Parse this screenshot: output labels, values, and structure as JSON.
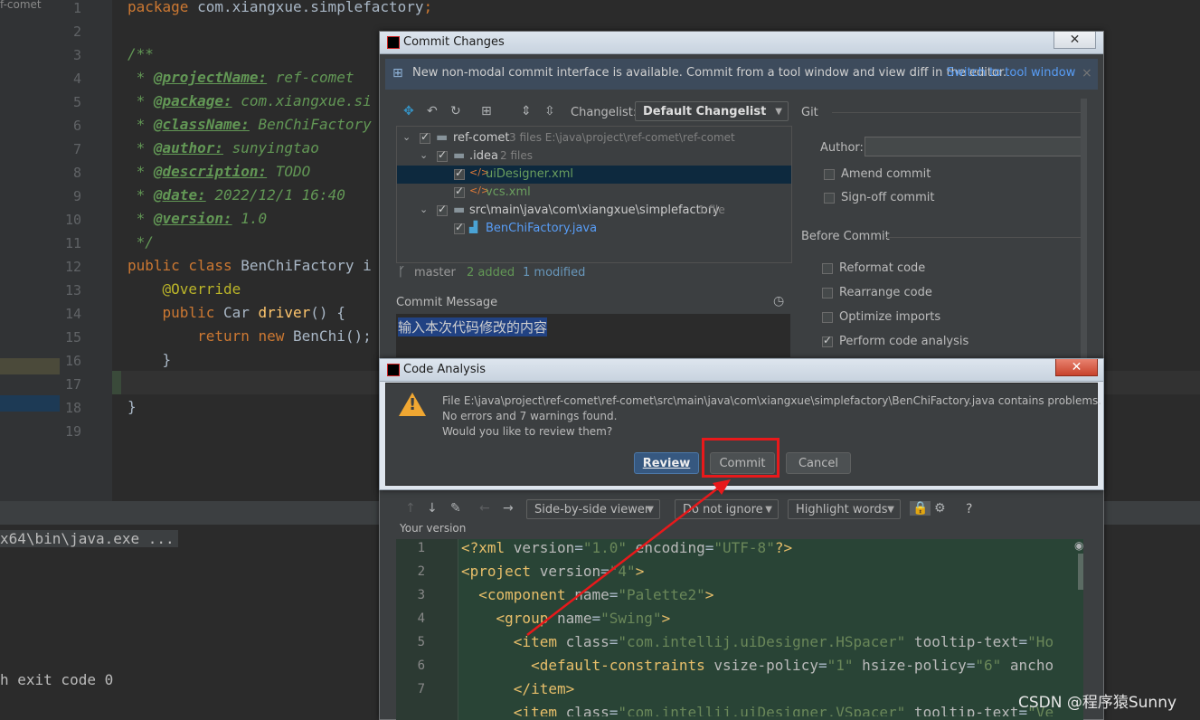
{
  "project_tab": "f-comet",
  "editor": {
    "line_numbers": [
      "1",
      "2",
      "3",
      "4",
      "5",
      "6",
      "7",
      "8",
      "9",
      "10",
      "11",
      "12",
      "13",
      "14",
      "15",
      "16",
      "17",
      "18",
      "19"
    ],
    "lines": [
      {
        "parts": [
          {
            "c": "kw",
            "t": "package "
          },
          {
            "c": "",
            "t": "com.xiangxue.simplefactory"
          },
          {
            "c": "kw",
            "t": ";"
          }
        ]
      },
      {
        "parts": []
      },
      {
        "parts": [
          {
            "c": "cm",
            "t": "/**"
          }
        ]
      },
      {
        "parts": [
          {
            "c": "cm",
            "t": " * "
          },
          {
            "c": "tag",
            "t": "@projectName:"
          },
          {
            "c": "cm",
            "t": " ref-comet"
          }
        ]
      },
      {
        "parts": [
          {
            "c": "cm",
            "t": " * "
          },
          {
            "c": "tag",
            "t": "@package:"
          },
          {
            "c": "cm",
            "t": " com.xiangxue.si"
          }
        ]
      },
      {
        "parts": [
          {
            "c": "cm",
            "t": " * "
          },
          {
            "c": "tag",
            "t": "@className:"
          },
          {
            "c": "cm",
            "t": " BenChiFactory"
          }
        ]
      },
      {
        "parts": [
          {
            "c": "cm",
            "t": " * "
          },
          {
            "c": "tag",
            "t": "@author:"
          },
          {
            "c": "cm",
            "t": " sunyingtao"
          }
        ]
      },
      {
        "parts": [
          {
            "c": "cm",
            "t": " * "
          },
          {
            "c": "tag",
            "t": "@description:"
          },
          {
            "c": "cm",
            "t": " TODO"
          }
        ]
      },
      {
        "parts": [
          {
            "c": "cm",
            "t": " * "
          },
          {
            "c": "tag",
            "t": "@date:"
          },
          {
            "c": "cm",
            "t": " 2022/12/1 16:40"
          }
        ]
      },
      {
        "parts": [
          {
            "c": "cm",
            "t": " * "
          },
          {
            "c": "tag",
            "t": "@version:"
          },
          {
            "c": "cm",
            "t": " 1.0"
          }
        ]
      },
      {
        "parts": [
          {
            "c": "cm",
            "t": " */"
          }
        ]
      },
      {
        "parts": [
          {
            "c": "kw",
            "t": "public class "
          },
          {
            "c": "",
            "t": "BenChiFactory i"
          }
        ]
      },
      {
        "parts": [
          {
            "c": "ann",
            "t": "    @Override"
          }
        ]
      },
      {
        "parts": [
          {
            "c": "kw",
            "t": "    public "
          },
          {
            "c": "",
            "t": "Car "
          },
          {
            "c": "fn",
            "t": "driver"
          },
          {
            "c": "",
            "t": "() {"
          }
        ]
      },
      {
        "parts": [
          {
            "c": "kw",
            "t": "        return new "
          },
          {
            "c": "",
            "t": "BenChi();"
          }
        ]
      },
      {
        "parts": [
          {
            "c": "",
            "t": "    }"
          }
        ]
      },
      {
        "parts": []
      },
      {
        "parts": [
          {
            "c": "",
            "t": "}"
          }
        ]
      },
      {
        "parts": []
      }
    ]
  },
  "console": {
    "line1": "x64\\bin\\java.exe ...",
    "line2": "h exit code 0"
  },
  "commit_dialog": {
    "title": "Commit Changes",
    "close": "✕",
    "notice": "New non-modal commit interface is available. Commit from a tool window and view diff in the editor.",
    "notice_link": "Switch to tool window",
    "changelist_label": "Changelist:",
    "changelist_value": "Default Changelist",
    "tree": {
      "root": {
        "name": "ref-comet",
        "meta": "3 files  E:\\java\\project\\ref-comet\\ref-comet"
      },
      "idea": {
        "name": ".idea",
        "meta": "2 files"
      },
      "file1": "uiDesigner.xml",
      "file2": "vcs.xml",
      "src": {
        "name": "src\\main\\java\\com\\xiangxue\\simplefactory",
        "meta": "1 file"
      },
      "file3": "BenChiFactory.java"
    },
    "branch": "master",
    "added": "2 added",
    "modified": "1 modified",
    "commit_message_label": "Commit Message",
    "commit_message": "输入本次代码修改的内容",
    "git_label": "Git",
    "author_label": "Author:",
    "amend": "Amend commit",
    "signoff": "Sign-off commit",
    "before_commit": "Before Commit",
    "checks": [
      {
        "label": "Reformat code",
        "on": false
      },
      {
        "label": "Rearrange code",
        "on": false
      },
      {
        "label": "Optimize imports",
        "on": false
      },
      {
        "label": "Perform code analysis",
        "on": true
      }
    ],
    "toolbar": {
      "viewer": "Side-by-side viewer",
      "ignore": "Do not ignore",
      "highlight": "Highlight words",
      "help": "?"
    },
    "your_version": "Your version",
    "diff_line_numbers": [
      "1",
      "2",
      "3",
      "4",
      "5",
      "6",
      "7"
    ]
  },
  "analysis_dialog": {
    "title": "Code Analysis",
    "close": "✕",
    "line1": "File E:\\java\\project\\ref-comet\\ref-comet\\src\\main\\java\\com\\xiangxue\\simplefactory\\BenChiFactory.java contains problems.",
    "line2": "No errors and 7 warnings found.",
    "line3": "Would you like to review them?",
    "review": "Review",
    "commit": "Commit",
    "cancel": "Cancel"
  },
  "watermark": "CSDN @程序猿Sunny",
  "colors": {
    "annotation_red": "#e8191b",
    "selection": "#214283",
    "diff_bg": "#294436"
  }
}
